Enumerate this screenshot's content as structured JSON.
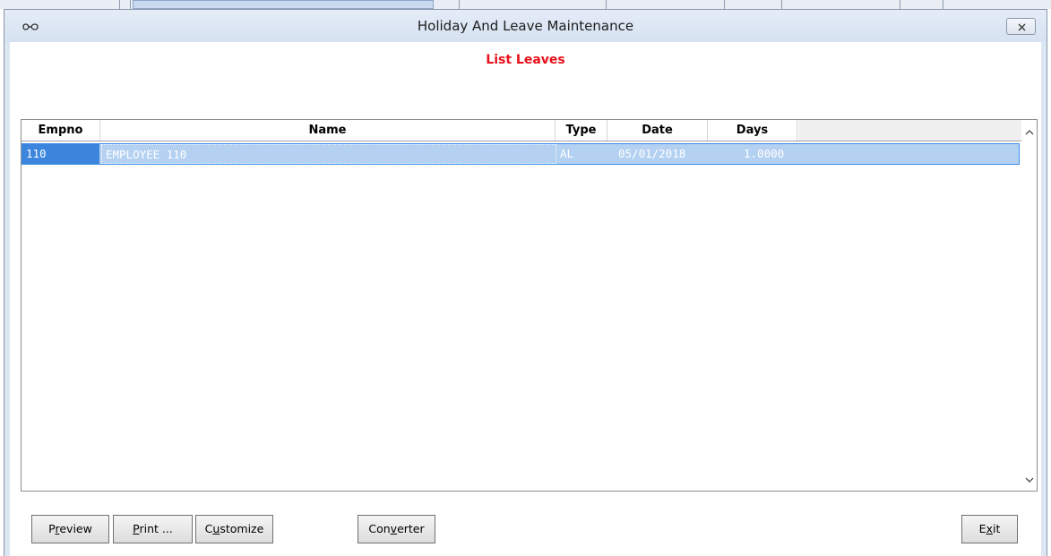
{
  "window": {
    "title": "Holiday And Leave Maintenance"
  },
  "heading": "List Leaves",
  "grid": {
    "columns": [
      "Empno",
      "Name",
      "Type",
      "Date",
      "Days"
    ],
    "rows": [
      {
        "empno": "110",
        "name": "EMPLOYEE 110",
        "type": "AL",
        "date": "05/01/2018",
        "days": "1.0000"
      }
    ]
  },
  "buttons": {
    "preview": {
      "pre": "P",
      "key": "r",
      "post": "eview"
    },
    "print": {
      "pre": "",
      "key": "P",
      "post": "rint ..."
    },
    "customize": {
      "pre": "C",
      "key": "u",
      "post": "stomize"
    },
    "converter": {
      "pre": "Con",
      "key": "v",
      "post": "erter"
    },
    "exit": {
      "pre": "E",
      "key": "x",
      "post": "it"
    }
  },
  "colors": {
    "heading": "#e8101a",
    "selection": "#b4d1f2",
    "selection_border": "#3a8ee6"
  },
  "icons": {
    "title": "glasses-icon",
    "close": "close-icon",
    "scroll_up": "chevron-up-icon",
    "scroll_down": "chevron-down-icon"
  }
}
